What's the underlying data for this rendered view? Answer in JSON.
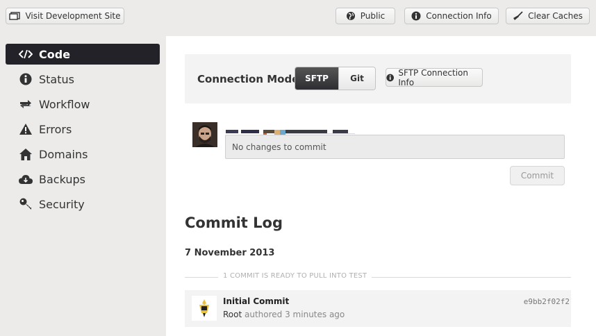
{
  "toolbar": {
    "visit_dev_site": "Visit Development Site",
    "public": "Public",
    "connection_info": "Connection Info",
    "clear_caches": "Clear Caches"
  },
  "sidebar": {
    "items": [
      {
        "label": "Code",
        "icon": "code-icon",
        "active": true
      },
      {
        "label": "Status",
        "icon": "info-icon"
      },
      {
        "label": "Workflow",
        "icon": "workflow-arrows-icon"
      },
      {
        "label": "Errors",
        "icon": "warning-icon"
      },
      {
        "label": "Domains",
        "icon": "home-icon"
      },
      {
        "label": "Backups",
        "icon": "cloud-icon"
      },
      {
        "label": "Security",
        "icon": "key-icon"
      }
    ]
  },
  "connection": {
    "label": "Connection Mode:",
    "modes": [
      "SFTP",
      "Git"
    ],
    "selected": "SFTP",
    "info_button": "SFTP Connection Info"
  },
  "commit_form": {
    "placeholder": "No changes to commit",
    "button": "Commit"
  },
  "commit_log": {
    "title": "Commit Log",
    "date": "7 November 2013",
    "divider_label": "1 COMMIT IS READY TO PULL INTO TEST",
    "commits": [
      {
        "message": "Initial Commit",
        "author": "Root",
        "action": "authored 3 minutes ago",
        "hash": "e9bb2f02f2"
      }
    ]
  },
  "colors": {
    "sidebar_active_bg": "#222228",
    "page_bg": "#ecebea",
    "panel_bg": "#ffffff"
  }
}
